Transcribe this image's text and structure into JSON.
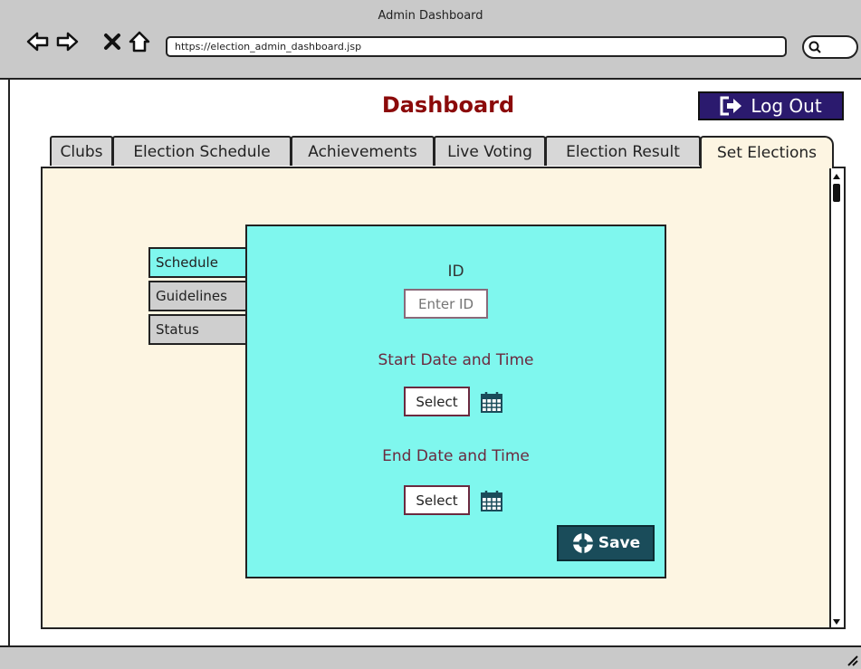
{
  "browser": {
    "window_title": "Admin Dashboard",
    "url": "https://election_admin_dashboard.jsp",
    "nav_icons": [
      "back-arrow-icon",
      "forward-arrow-icon",
      "close-icon",
      "home-icon"
    ],
    "search_icon": "search-icon"
  },
  "header": {
    "title": "Dashboard",
    "logout_label": "Log Out",
    "logout_icon": "logout-icon"
  },
  "tabs": [
    {
      "label": "Clubs"
    },
    {
      "label": "Election Schedule"
    },
    {
      "label": "Achievements"
    },
    {
      "label": "Live Voting"
    },
    {
      "label": "Election Result"
    },
    {
      "label": "Set Elections",
      "active": true
    }
  ],
  "side_tabs": [
    {
      "label": "Schedule",
      "active": true
    },
    {
      "label": "Guidelines"
    },
    {
      "label": "Status"
    }
  ],
  "form": {
    "id_label": "ID",
    "id_placeholder": "Enter ID",
    "start_label": "Start Date and Time",
    "start_select_label": "Select",
    "end_label": "End Date and Time",
    "end_select_label": "Select",
    "calendar_icon": "calendar-icon",
    "save_label": "Save",
    "save_icon": "lifebuoy-icon"
  },
  "colors": {
    "title": "#8b0a0a",
    "logout_bg": "#2b1a6e",
    "panel_bg": "#fdf5e2",
    "form_bg": "#7ff7ee",
    "save_bg": "#1a4c5a",
    "chrome_bg": "#c9c9c9"
  }
}
